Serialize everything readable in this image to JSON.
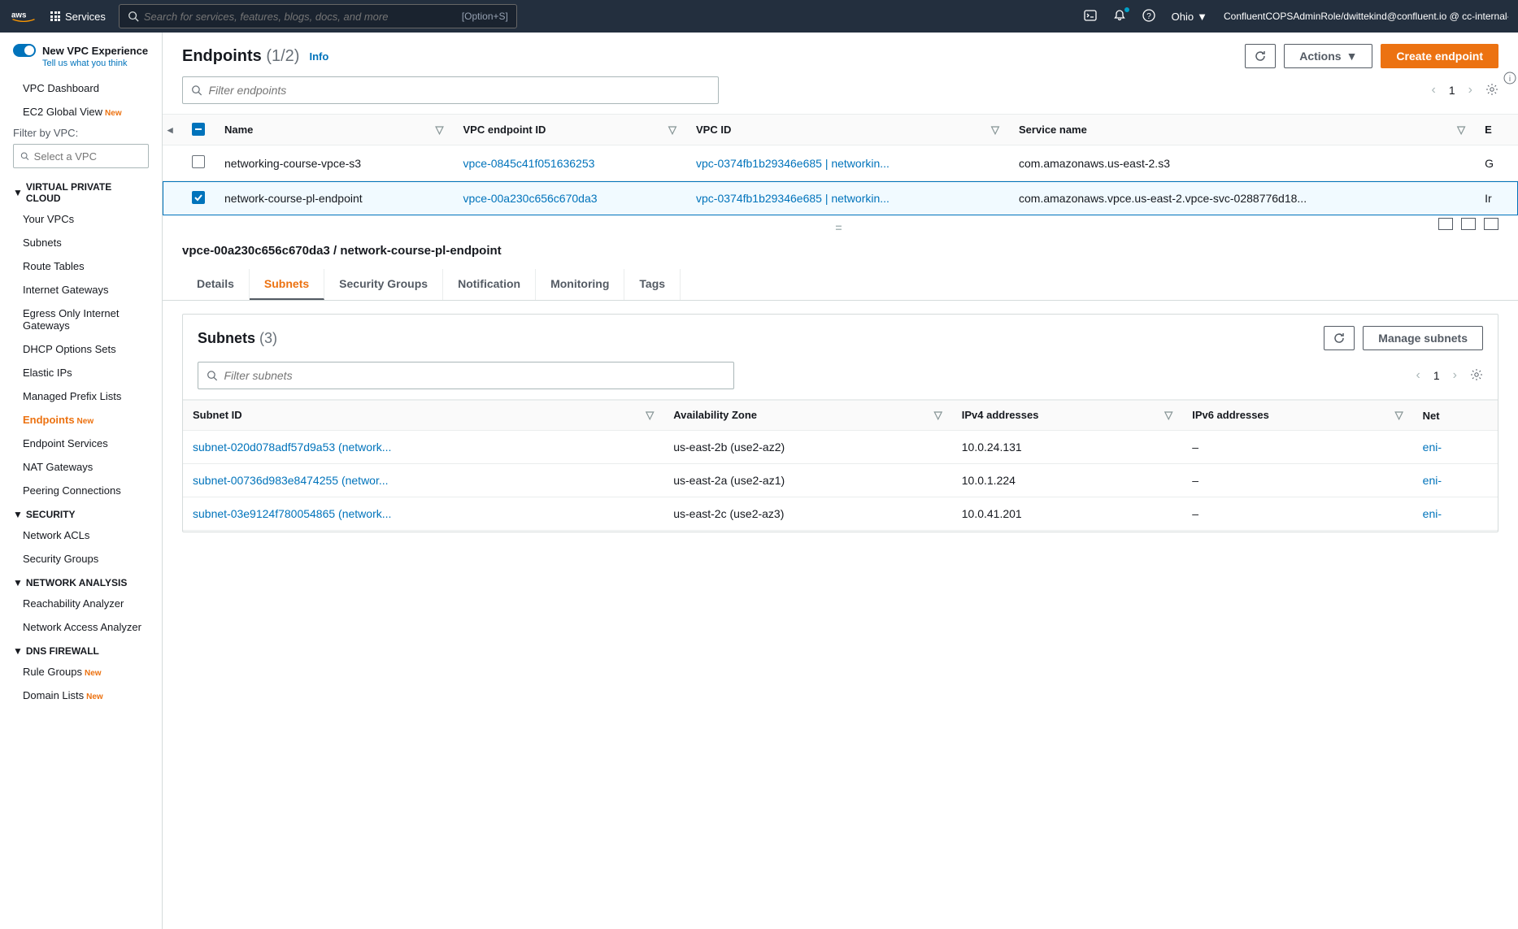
{
  "nav": {
    "services_label": "Services",
    "search_placeholder": "Search for services, features, blogs, docs, and more",
    "search_shortcut": "[Option+S]",
    "region": "Ohio",
    "account": "ConfluentCOPSAdminRole/dwittekind@confluent.io @ cc-internal-..."
  },
  "sidebar": {
    "toggle_title": "New VPC Experience",
    "toggle_sub": "Tell us what you think",
    "items_top": [
      "VPC Dashboard"
    ],
    "ec2_label": "EC2 Global View",
    "filter_label": "Filter by VPC:",
    "filter_placeholder": "Select a VPC",
    "sections": [
      {
        "title": "VIRTUAL PRIVATE CLOUD",
        "items": [
          {
            "label": "Your VPCs"
          },
          {
            "label": "Subnets"
          },
          {
            "label": "Route Tables"
          },
          {
            "label": "Internet Gateways"
          },
          {
            "label": "Egress Only Internet Gateways"
          },
          {
            "label": "DHCP Options Sets"
          },
          {
            "label": "Elastic IPs"
          },
          {
            "label": "Managed Prefix Lists"
          },
          {
            "label": "Endpoints",
            "new": true,
            "active": true
          },
          {
            "label": "Endpoint Services"
          },
          {
            "label": "NAT Gateways"
          },
          {
            "label": "Peering Connections"
          }
        ]
      },
      {
        "title": "SECURITY",
        "items": [
          {
            "label": "Network ACLs"
          },
          {
            "label": "Security Groups"
          }
        ]
      },
      {
        "title": "NETWORK ANALYSIS",
        "items": [
          {
            "label": "Reachability Analyzer"
          },
          {
            "label": "Network Access Analyzer"
          }
        ]
      },
      {
        "title": "DNS FIREWALL",
        "items": [
          {
            "label": "Rule Groups",
            "new": true
          },
          {
            "label": "Domain Lists",
            "new": true
          }
        ]
      }
    ]
  },
  "page": {
    "title": "Endpoints",
    "count": "(1/2)",
    "info": "Info",
    "actions_label": "Actions",
    "create_label": "Create endpoint",
    "filter_placeholder": "Filter endpoints",
    "page_num": "1"
  },
  "table": {
    "headers": [
      "Name",
      "VPC endpoint ID",
      "VPC ID",
      "Service name",
      "E"
    ],
    "rows": [
      {
        "checked": false,
        "name": "networking-course-vpce-s3",
        "endpoint_id": "vpce-0845c41f051636253",
        "vpc_id": "vpc-0374fb1b29346e685 | networkin...",
        "service": "com.amazonaws.us-east-2.s3",
        "extra": "G"
      },
      {
        "checked": true,
        "name": "network-course-pl-endpoint",
        "endpoint_id": "vpce-00a230c656c670da3",
        "vpc_id": "vpc-0374fb1b29346e685 | networkin...",
        "service": "com.amazonaws.vpce.us-east-2.vpce-svc-0288776d18...",
        "extra": "Ir"
      }
    ]
  },
  "detail": {
    "title": "vpce-00a230c656c670da3 / network-course-pl-endpoint",
    "tabs": [
      "Details",
      "Subnets",
      "Security Groups",
      "Notification",
      "Monitoring",
      "Tags"
    ],
    "active_tab": 1,
    "subnets": {
      "title": "Subnets",
      "count": "(3)",
      "manage_label": "Manage subnets",
      "filter_placeholder": "Filter subnets",
      "page_num": "1",
      "headers": [
        "Subnet ID",
        "Availability Zone",
        "IPv4 addresses",
        "IPv6 addresses",
        "Net"
      ],
      "rows": [
        {
          "subnet": "subnet-020d078adf57d9a53 (network...",
          "az": "us-east-2b (use2-az2)",
          "ipv4": "10.0.24.131",
          "ipv6": "–",
          "net": "eni-"
        },
        {
          "subnet": "subnet-00736d983e8474255 (networ...",
          "az": "us-east-2a (use2-az1)",
          "ipv4": "10.0.1.224",
          "ipv6": "–",
          "net": "eni-"
        },
        {
          "subnet": "subnet-03e9124f780054865 (network...",
          "az": "us-east-2c (use2-az3)",
          "ipv4": "10.0.41.201",
          "ipv6": "–",
          "net": "eni-"
        }
      ]
    }
  }
}
